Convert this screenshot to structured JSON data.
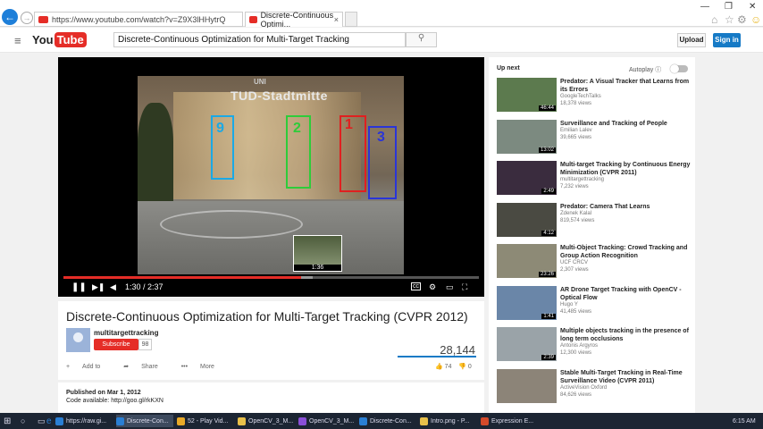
{
  "browser": {
    "url": "https://www.youtube.com/watch?v=Z9X3lHHytrQ",
    "tab_title": "Discrete-Continuous Optimi...",
    "tab_close": "×"
  },
  "youtube": {
    "logo_you": "You",
    "logo_tube": "Tube",
    "search_value": "Discrete-Continuous Optimization for Multi-Target Tracking",
    "upload_label": "Upload",
    "signin_label": "Sign in"
  },
  "player": {
    "frame_sign": "TUD-Stadtmitte",
    "frame_logo": "UNI",
    "boxes": [
      {
        "label": "9",
        "color": "#1aa9e6"
      },
      {
        "label": "2",
        "color": "#2ecc3a"
      },
      {
        "label": "1",
        "color": "#e02020"
      },
      {
        "label": "3",
        "color": "#2a35d8"
      }
    ],
    "preview_time": "1:36",
    "time_display": "1:30 / 2:37",
    "progress_played": 0.573
  },
  "video": {
    "title": "Discrete-Continuous Optimization for Multi-Target Tracking (CVPR 2012)",
    "channel": "multitargettracking",
    "subscribe_label": "Subscribe",
    "subscriber_count": "98",
    "view_count": "28,144",
    "add_to_label": "Add to",
    "share_label": "Share",
    "more_label": "More",
    "likes": "74",
    "dislikes": "0",
    "published": "Published on Mar 1, 2012",
    "code_line": "Code available: http://goo.gl/rkKXN"
  },
  "sidebar": {
    "up_next_label": "Up next",
    "autoplay_label": "Autoplay",
    "recommendations": [
      {
        "title": "Predator: A Visual Tracker that Learns from its Errors",
        "channel": "GoogleTechTalks",
        "views": "18,378 views",
        "duration": "46:44",
        "thumb_color": "#5c7a4e"
      },
      {
        "title": "Surveillance and Tracking of People",
        "channel": "Emilian Lalev",
        "views": "39,665 views",
        "duration": "13:02",
        "thumb_color": "#7c8a80"
      },
      {
        "title": "Multi-target Tracking by Continuous Energy Minimization (CVPR 2011)",
        "channel": "multitargettracking",
        "views": "7,232 views",
        "duration": "2:49",
        "thumb_color": "#3a2c3e"
      },
      {
        "title": "Predator: Camera That Learns",
        "channel": "Zdenek Kalal",
        "views": "819,574 views",
        "duration": "4:12",
        "thumb_color": "#4a4a42"
      },
      {
        "title": "Multi-Object Tracking: Crowd Tracking and Group Action Recognition",
        "channel": "UCF CRCV",
        "views": "2,307 views",
        "duration": "23:26",
        "thumb_color": "#8d8a76"
      },
      {
        "title": "AR Drone Target Tracking with OpenCV - Optical Flow",
        "channel": "Hugo Y",
        "views": "41,485 views",
        "duration": "1:41",
        "thumb_color": "#6a86a8"
      },
      {
        "title": "Multiple objects tracking in the presence of long term occlusions",
        "channel": "Antonis Argyros",
        "views": "12,300 views",
        "duration": "2:39",
        "thumb_color": "#9aa3a8"
      },
      {
        "title": "Stable Multi-Target Tracking in Real-Time Surveillance Video (CVPR 2011)",
        "channel": "ActiveVision Oxford",
        "views": "84,626 views",
        "duration": "",
        "thumb_color": "#8c8478"
      }
    ]
  },
  "taskbar": {
    "items": [
      {
        "label": "https://raw.gi...",
        "color": "#2a7fd4"
      },
      {
        "label": "Discrete-Con...",
        "color": "#2a7fd4"
      },
      {
        "label": "52 - Play Vid...",
        "color": "#e8a928"
      },
      {
        "label": "OpenCV_3_M...",
        "color": "#e8c04a"
      },
      {
        "label": "OpenCV_3_M...",
        "color": "#8a4fd8"
      },
      {
        "label": "Discrete-Con...",
        "color": "#2a7fd4"
      },
      {
        "label": "Intro.png - P...",
        "color": "#e8c04a"
      },
      {
        "label": "Expression E...",
        "color": "#d44a2a"
      }
    ],
    "clock": "6:15 AM"
  }
}
